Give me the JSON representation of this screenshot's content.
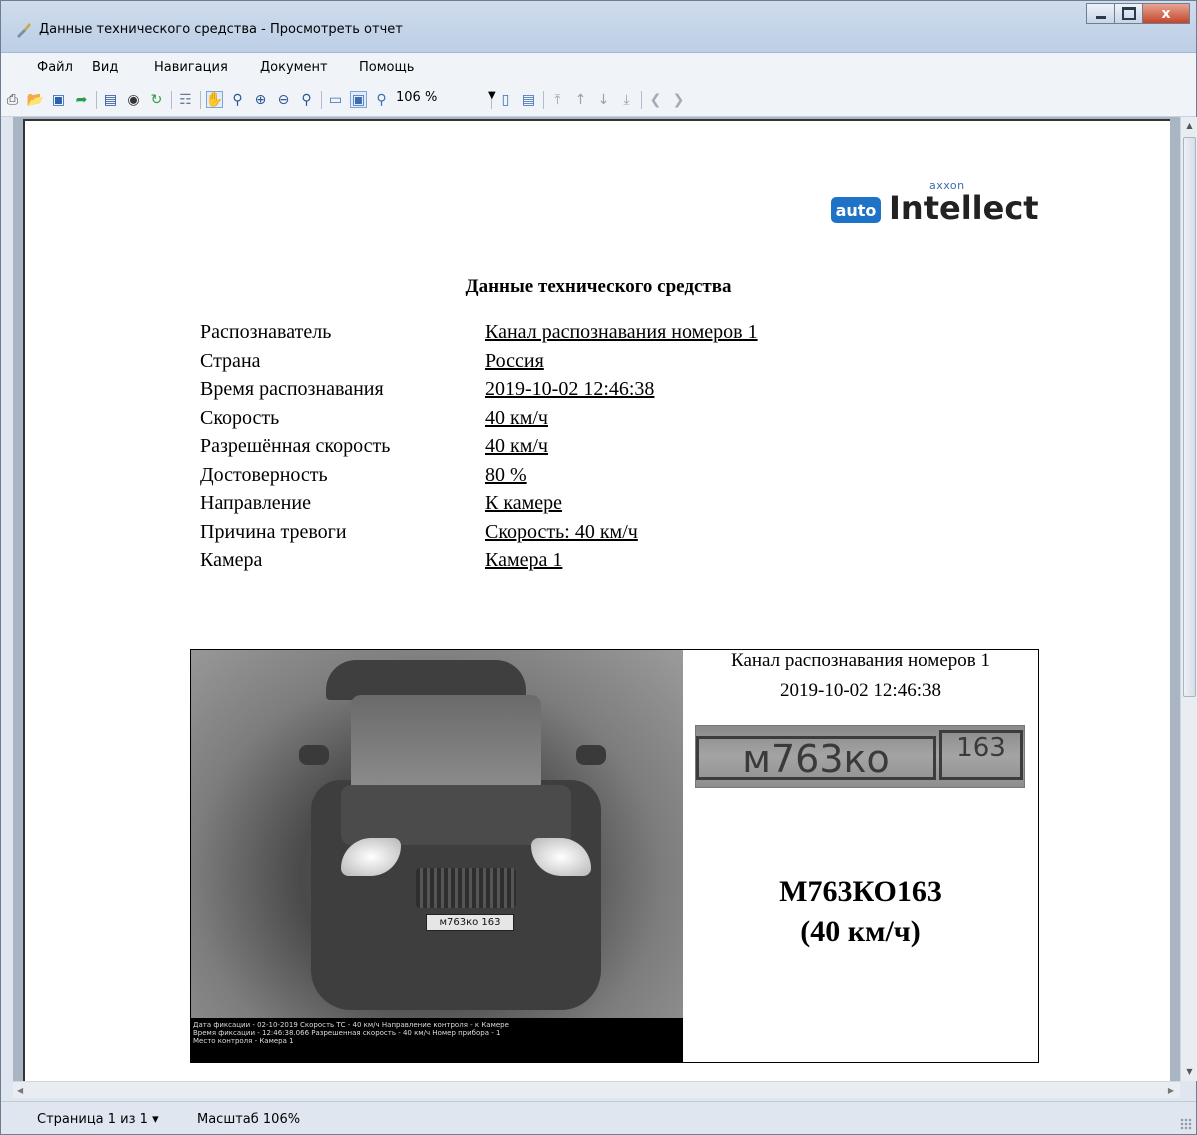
{
  "window": {
    "title": "Данные технического средства - Просмотреть отчет",
    "buttons": {
      "close": "x"
    }
  },
  "menu": [
    "Файл",
    "Вид",
    "Навигация",
    "Документ",
    "Помощь"
  ],
  "toolbar": {
    "zoom_value": "106 %",
    "icons": [
      "print-icon",
      "open-icon",
      "save-icon",
      "export-icon",
      "table-icon",
      "find-icon",
      "refresh-icon",
      "preview-icon",
      "hand-tool-icon",
      "zoom-icon",
      "zoom-in-icon",
      "zoom-out-icon",
      "zoom-area-icon",
      "single-page-icon",
      "page-width-icon",
      "actual-size-icon",
      "blank-page-icon",
      "layout-icon",
      "first-page-icon",
      "previous-page-icon",
      "next-page-icon",
      "last-page-icon",
      "back-icon",
      "forward-icon"
    ]
  },
  "report": {
    "logo": {
      "maker": "axxon",
      "badge": "auto",
      "brand": "Intellect"
    },
    "title": "Данные технического средства",
    "fields": [
      {
        "label": "Распознаватель",
        "value": "Канал распознавания номеров 1"
      },
      {
        "label": "Страна",
        "value": "Россия"
      },
      {
        "label": "Время распознавания",
        "value": "2019-10-02 12:46:38"
      },
      {
        "label": "Скорость",
        "value": "40 км/ч"
      },
      {
        "label": "Разрешённая скорость",
        "value": "40 км/ч"
      },
      {
        "label": "Достоверность",
        "value": "80 %"
      },
      {
        "label": "Направление",
        "value": "К камере"
      },
      {
        "label": "Причина тревоги",
        "value": "Скорость: 40 км/ч"
      },
      {
        "label": "Камера",
        "value": "Камера 1"
      }
    ],
    "evidence": {
      "photo_plate": "м763ко 163",
      "overlay_lines": [
        "Дата фиксации - 02-10-2019  Скорость ТС - 40 км/ч          Направление контроля - к Камере",
        "Время фиксации - 12:46:38.066     Разрешенная скорость - 40 км/ч     Номер прибора - 1",
        "Место контроля - Камера 1"
      ],
      "channel": "Канал распознавания номеров 1",
      "time": "2019-10-02 12:46:38",
      "plate_number": "м763ко",
      "plate_region": "163",
      "plate_text": "М763КО163",
      "speed_text": "(40 км/ч)"
    }
  },
  "status": {
    "page": "Страница 1 из 1 ▾",
    "zoom": "Масштаб 106%"
  }
}
